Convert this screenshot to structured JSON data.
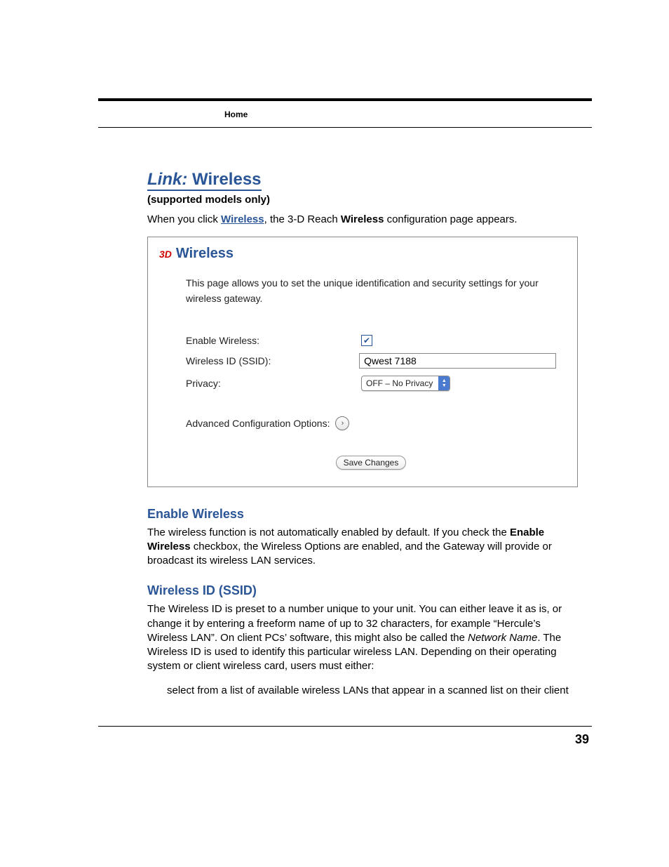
{
  "header": {
    "running_head": "Home"
  },
  "title": {
    "prefix": "Link:",
    "main": "Wireless"
  },
  "subtitle": "(supported models only)",
  "intro": {
    "pre": "When you click ",
    "link": "Wireless",
    "mid": ", the 3-D Reach ",
    "bold": "Wireless",
    "post": " configuration page appears."
  },
  "figure": {
    "badge": "3D",
    "title": "Wireless",
    "description": "This page allows you to set the unique identification and security settings for your wireless gateway.",
    "fields": {
      "enable_label": "Enable Wireless:",
      "enable_checked": "✔",
      "ssid_label": "Wireless ID (SSID):",
      "ssid_value": "Qwest 7188",
      "privacy_label": "Privacy:",
      "privacy_value": "OFF – No Privacy"
    },
    "advanced_label": "Advanced Configuration Options:",
    "advanced_arrow": "›",
    "save_label": "Save Changes"
  },
  "sections": {
    "enable": {
      "title": "Enable Wireless",
      "body_pre": "The wireless function is not automatically enabled by default. If you check the ",
      "body_bold": "Enable Wireless",
      "body_post": " checkbox, the Wireless Options are enabled, and the Gateway will provide or broadcast its wireless LAN services."
    },
    "ssid": {
      "title": "Wireless ID (SSID)",
      "body_pre": "The Wireless ID is preset to a number unique to your unit. You can either leave it as is, or change it by entering a freeform name of up to 32 characters, for example “Hercule’s Wireless LAN”. On client PCs’ software, this might also be called the ",
      "body_italic": "Network Name",
      "body_post": ". The Wireless ID is used to identify this particular wireless LAN. Depending on their operating system or client wireless card, users must either:",
      "bullet1": "select from a list of available wireless LANs that appear in a scanned list on their client"
    }
  },
  "page_number": "39"
}
